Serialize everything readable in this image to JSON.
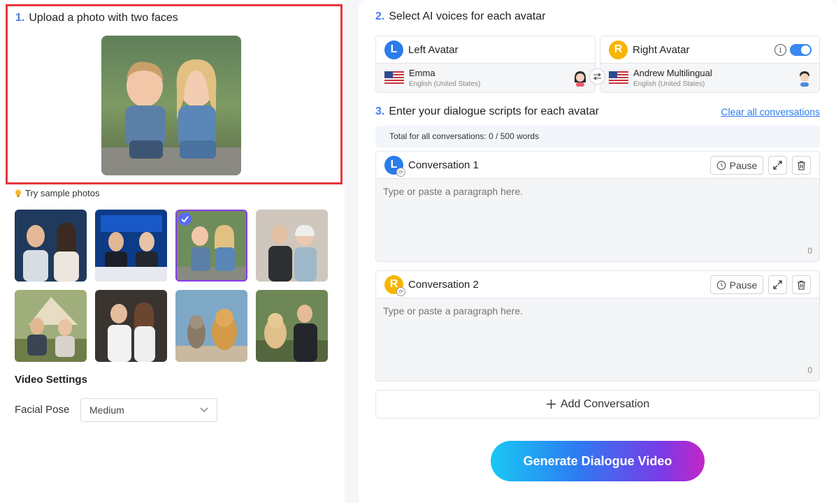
{
  "left_panel": {
    "step1": {
      "num": "1.",
      "title": "Upload a photo with two faces"
    },
    "sample_label": "Try sample photos",
    "thumbnails": [
      {
        "name": "sample-couple-studio",
        "selected": false
      },
      {
        "name": "sample-news-anchors",
        "selected": false
      },
      {
        "name": "sample-kids",
        "selected": true
      },
      {
        "name": "sample-elderly-couple",
        "selected": false
      },
      {
        "name": "sample-camping",
        "selected": false
      },
      {
        "name": "sample-young-couple",
        "selected": false
      },
      {
        "name": "sample-cat-dog",
        "selected": false
      },
      {
        "name": "sample-man-dog",
        "selected": false
      }
    ],
    "video_settings": "Video Settings",
    "facial_pose_label": "Facial Pose",
    "facial_pose_value": "Medium"
  },
  "right_panel": {
    "step2": {
      "num": "2.",
      "title": "Select AI voices for each avatar"
    },
    "left_avatar": {
      "badge": "L",
      "label": "Left Avatar",
      "voice": "Emma",
      "lang": "English (United States)"
    },
    "right_avatar": {
      "badge": "R",
      "label": "Right Avatar",
      "voice": "Andrew Multilingual",
      "lang": "English (United States)",
      "toggle_on": true
    },
    "step3": {
      "num": "3.",
      "title": "Enter your dialogue scripts for each avatar"
    },
    "clear_link": "Clear all conversations",
    "total": "Total for all conversations: 0 / 500 words",
    "conversations": [
      {
        "badge": "L",
        "title": "Conversation 1",
        "pause": "Pause",
        "placeholder": "Type or paste a paragraph here.",
        "count": "0"
      },
      {
        "badge": "R",
        "title": "Conversation 2",
        "pause": "Pause",
        "placeholder": "Type or paste a paragraph here.",
        "count": "0"
      }
    ],
    "add_conversation": "Add Conversation",
    "generate": "Generate Dialogue Video"
  },
  "colors": {
    "accent": "#4a7cf5",
    "left_badge": "#2b7bea",
    "right_badge": "#f7b500",
    "highlight_border": "#e8363c"
  }
}
